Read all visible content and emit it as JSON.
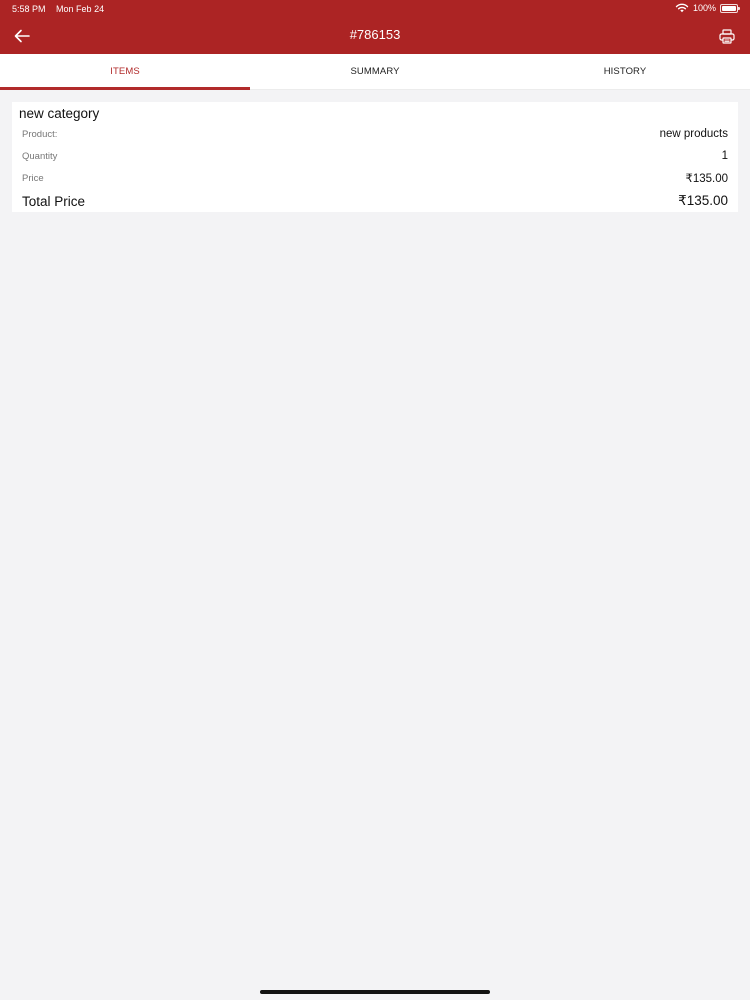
{
  "status_bar": {
    "time": "5:58 PM",
    "date": "Mon Feb 24",
    "battery_text": "100%",
    "icons": [
      "wifi-icon",
      "battery-icon"
    ]
  },
  "nav": {
    "title": "#786153",
    "back_icon": "arrow-left-icon",
    "print_icon": "printer-icon"
  },
  "tabs": [
    {
      "label": "ITEMS",
      "active": true
    },
    {
      "label": "SUMMARY",
      "active": false
    },
    {
      "label": "HISTORY",
      "active": false
    }
  ],
  "item": {
    "category": "new category",
    "product_label": "Product:",
    "product_value": "new products",
    "quantity_label": "Quantity",
    "quantity_value": "1",
    "price_label": "Price",
    "price_value": "₹135.00",
    "total_label": "Total Price",
    "total_value": "₹135.00"
  },
  "colors": {
    "header": "#ac2424",
    "accent": "#b12a2a",
    "background": "#f3f3f5"
  }
}
